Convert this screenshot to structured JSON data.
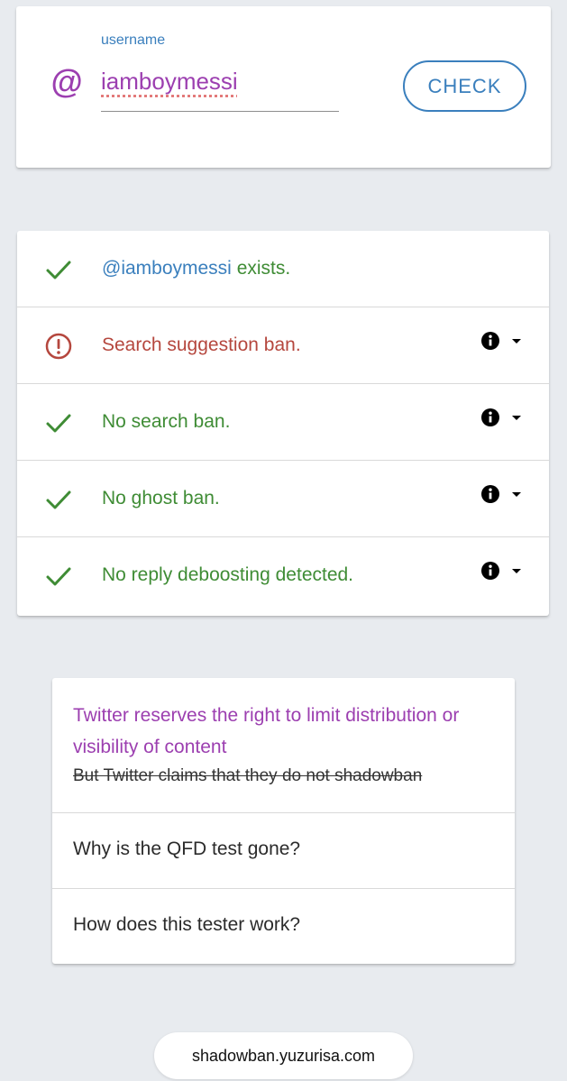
{
  "form": {
    "at_symbol": "@",
    "label": "username",
    "value": "iamboymessi",
    "check_label": "CHECK"
  },
  "results": [
    {
      "status": "ok",
      "handle": "@iamboymessi",
      "text": " exists.",
      "has_info": false
    },
    {
      "status": "warn",
      "text": "Search suggestion ban.",
      "has_info": true
    },
    {
      "status": "ok",
      "text": "No search ban.",
      "has_info": true
    },
    {
      "status": "ok",
      "text": "No ghost ban.",
      "has_info": true
    },
    {
      "status": "ok",
      "text": "No reply deboosting detected.",
      "has_info": true
    }
  ],
  "faq": {
    "title": "Twitter reserves the right to limit distribution or visibility of content",
    "strike": "But Twitter claims that they do not shadowban",
    "questions": [
      "Why is the QFD test gone?",
      "How does this tester work?"
    ]
  },
  "footer": {
    "url": "shadowban.yuzurisa.com"
  },
  "colors": {
    "ok": "#3f8c35",
    "warn": "#b5473e",
    "accent": "#3a7fbd",
    "purple": "#9c3fb0"
  },
  "icons": {
    "ok": "checkmark-icon",
    "warn": "exclamation-circle-icon",
    "info": "info-icon",
    "dropdown": "caret-down-icon"
  }
}
